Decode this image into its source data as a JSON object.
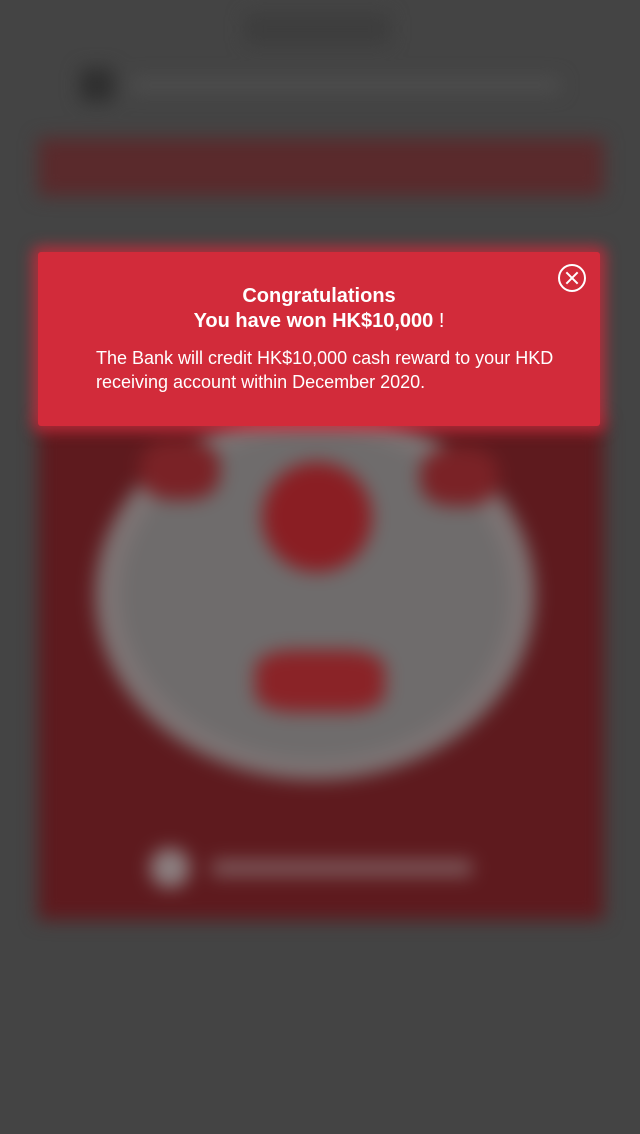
{
  "colors": {
    "overlay_background": "#444444",
    "modal_background": "#d22b3a",
    "modal_text": "#ffffff"
  },
  "modal": {
    "heading_line1": "Congratulations",
    "heading_line2": "You have won HK$10,000",
    "heading_line2_suffix": "!",
    "body": "The Bank will credit HK$10,000 cash reward to your HKD receiving account within December 2020.",
    "close_icon": "close-circle-icon"
  }
}
